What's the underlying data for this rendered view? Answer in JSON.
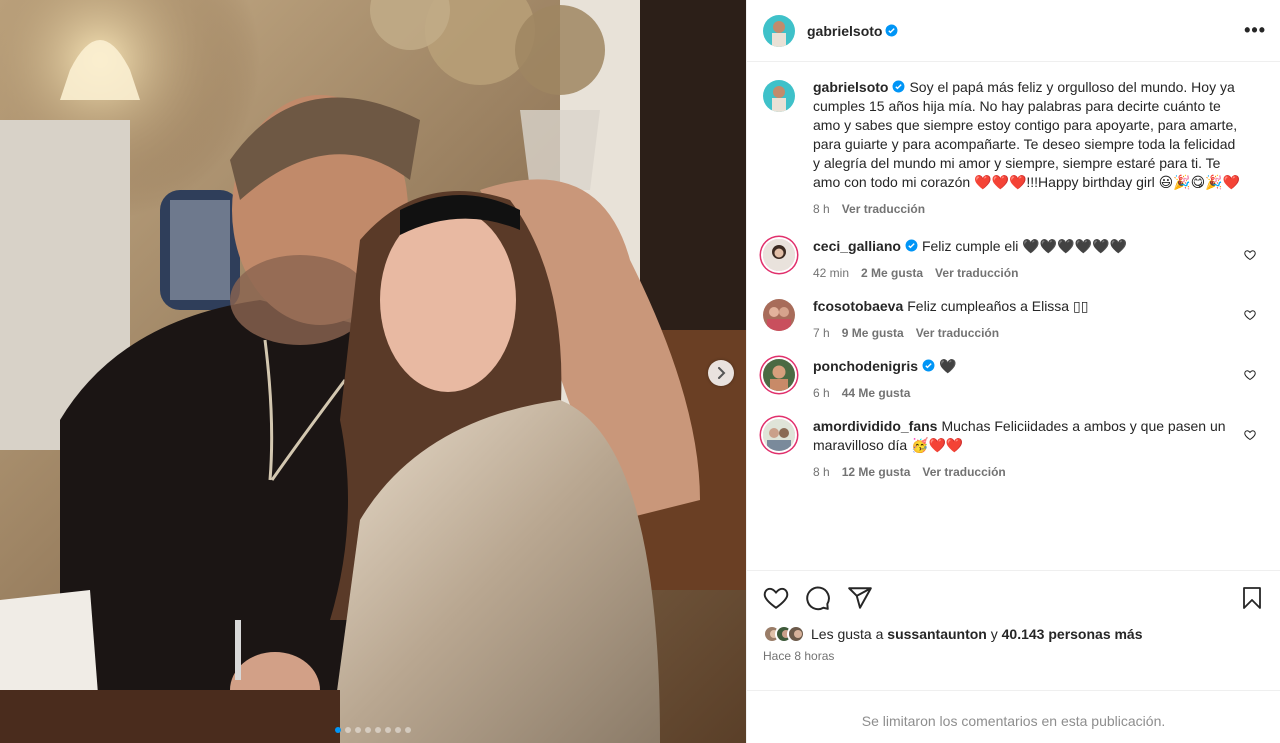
{
  "post": {
    "author": "gabrielsoto",
    "caption": "Soy el papá más feliz y orgulloso del mundo. Hoy ya cumples 15 años hija mía. No hay palabras para decirte cuánto te amo y sabes que siempre estoy contigo para apoyarte, para amarte, para guiarte y para acompañarte. Te deseo siempre toda la felicidad y alegría del mundo mi amor y siempre, siempre estaré para ti. Te amo con todo mi corazón ❤️❤️❤️!!!Happy birthday girl 😃🎉😋🎉❤️",
    "caption_time": "8 h",
    "caption_translate": "Ver traducción",
    "more_label": "•••"
  },
  "comments": [
    {
      "user": "ceci_galliano",
      "verified": true,
      "text": "Feliz cumple eli 🖤🖤🖤🖤🖤🖤",
      "time": "42 min",
      "likes": "2 Me gusta",
      "translate": "Ver traducción"
    },
    {
      "user": "fcosotobaeva",
      "verified": false,
      "text": "Feliz cumpleaños a Elissa ▯▯",
      "time": "7 h",
      "likes": "9 Me gusta",
      "translate": "Ver traducción"
    },
    {
      "user": "ponchodenigris",
      "verified": true,
      "text": "🖤",
      "time": "6 h",
      "likes": "44 Me gusta",
      "translate": ""
    },
    {
      "user": "amordividido_fans",
      "verified": false,
      "text": "Muchas Feliciidades a ambos y que pasen un maravilloso día 🥳❤️❤️",
      "time": "8 h",
      "likes": "12 Me gusta",
      "translate": "Ver traducción"
    }
  ],
  "likes": {
    "prefix": "Les gusta a",
    "user": "sussantaunton",
    "connector": "y",
    "count": "40.143 personas más"
  },
  "posted_time": "Hace 8 horas",
  "comments_limited": "Se limitaron los comentarios en esta publicación.",
  "carousel": {
    "total": 8,
    "active": 1
  },
  "colors": {
    "accent": "#0095f6",
    "verified": "#0095f6",
    "secondary_text": "#737373"
  },
  "icons": [
    "heart-icon",
    "comment-icon",
    "share-icon",
    "bookmark-icon",
    "chevron-right-icon",
    "more-icon",
    "verified-icon"
  ]
}
